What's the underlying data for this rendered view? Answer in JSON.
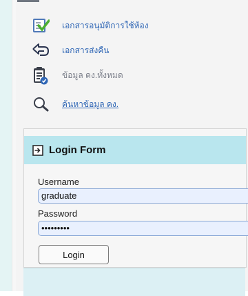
{
  "menu": {
    "items": [
      {
        "label": "เอกสารอนุมัติการใช้ห้อง",
        "icon": "checklist-icon",
        "style": "link-blue"
      },
      {
        "label": "เอกสารส่งคืน",
        "icon": "return-arrow-icon",
        "style": "link-blue"
      },
      {
        "label": "ข้อมูล คง.ทั้งหมด",
        "icon": "clipboard-check-icon",
        "style": "muted"
      },
      {
        "label": "ค้นหาข้อมูล คง.",
        "icon": "magnifier-icon",
        "style": "underlined-link"
      }
    ]
  },
  "login_form": {
    "title": "Login Form",
    "header_icon": "arrow-box-icon",
    "username_label": "Username",
    "username_value": "graduate",
    "password_label": "Password",
    "password_value": "•••••••••",
    "button_label": "Login"
  },
  "colors": {
    "link_blue": "#2f66b5",
    "muted_gray": "#7b7f8a",
    "header_bg": "#b9e6ee",
    "input_bg": "#e9f0fe",
    "left_strip": "#e4f4f4"
  }
}
